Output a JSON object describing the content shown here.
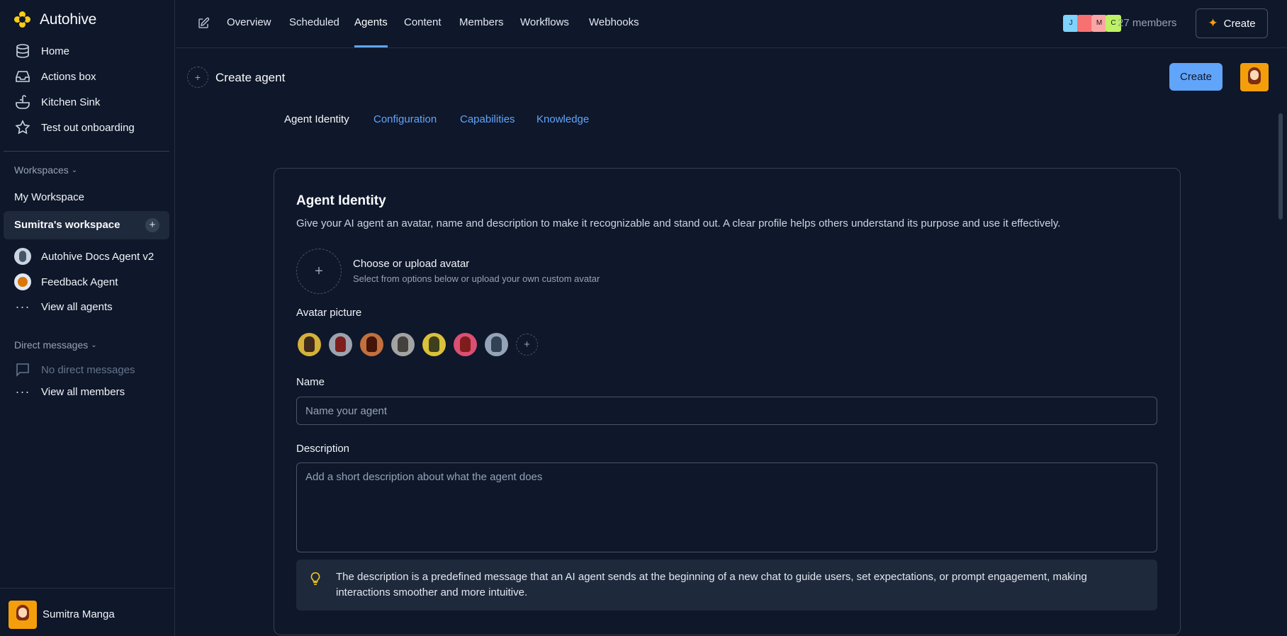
{
  "brand": {
    "name": "Autohive",
    "logo_color": "#facc15"
  },
  "sidebar": {
    "nav": [
      {
        "label": "Home",
        "icon": "database-icon"
      },
      {
        "label": "Actions box",
        "icon": "inbox-icon"
      },
      {
        "label": "Kitchen Sink",
        "icon": "sink-icon"
      },
      {
        "label": "Test out onboarding",
        "icon": "star-icon"
      }
    ],
    "workspaces_title": "Workspaces",
    "workspaces": [
      "My Workspace",
      "Sumitra's workspace"
    ],
    "agents": [
      "Autohive Docs Agent v2",
      "Feedback Agent"
    ],
    "view_all_agents": "View all agents",
    "direct_messages_title": "Direct messages",
    "no_direct_messages": "No direct messages",
    "view_all_members": "View all members",
    "user_name": "Sumitra Manga"
  },
  "topnav": {
    "tabs": [
      "Overview",
      "Scheduled",
      "Agents",
      "Content",
      "Members",
      "Workflows",
      "Webhooks"
    ],
    "active_tab": "Agents",
    "member_initials": [
      "J",
      "",
      "M",
      "C"
    ],
    "members_count": "27 members",
    "create_label": "Create"
  },
  "page": {
    "title": "Create agent",
    "create_button": "Create",
    "subtabs": [
      "Agent Identity",
      "Configuration",
      "Capabilities",
      "Knowledge"
    ],
    "active_subtab": "Agent Identity"
  },
  "card": {
    "title": "Agent Identity",
    "description": "Give your AI agent an avatar, name and description to make it recognizable and stand out. A clear profile helps others understand its purpose and use it effectively.",
    "upload_title": "Choose or upload avatar",
    "upload_subtitle": "Select from options below or upload your own custom avatar",
    "avatar_label": "Avatar picture",
    "avatar_colors": [
      "#d4b13a",
      "#9ca3af",
      "#c2703d",
      "#a3a3a3",
      "#d9c23a",
      "#db4f73",
      "#94a3b8"
    ],
    "name_label": "Name",
    "name_placeholder": "Name your agent",
    "name_value": "",
    "description_label": "Description",
    "description_placeholder": "Add a short description about what the agent does",
    "description_value": "",
    "hint": "The description is a predefined message that an AI agent sends at the beginning of a new chat to guide users, set expectations, or prompt engagement, making interactions smoother and more intuitive."
  },
  "colors": {
    "accent": "#60a5fa",
    "background": "#0f172a",
    "panel": "#1e293b"
  }
}
